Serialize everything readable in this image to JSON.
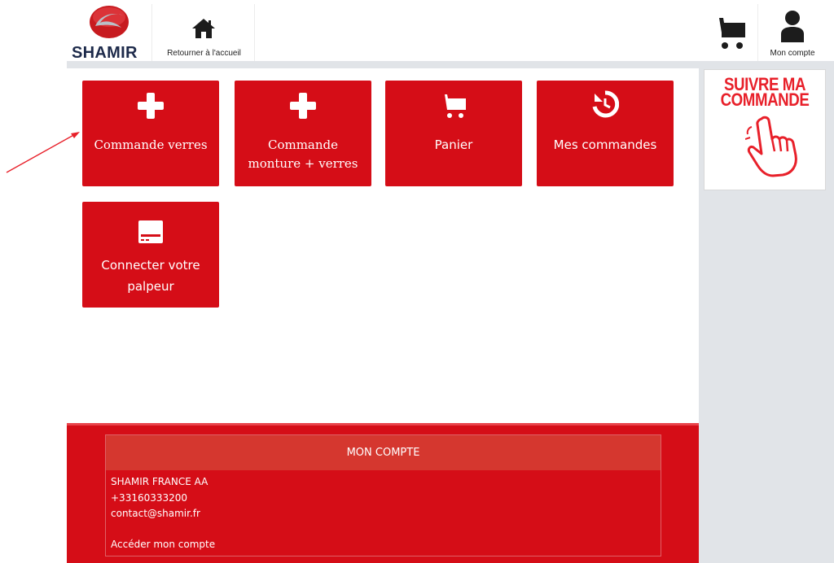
{
  "brand": {
    "name": "SHAMIR"
  },
  "header": {
    "home_label": "Retourner à l'accueil",
    "account_label": "Mon compte"
  },
  "promo": {
    "line1": "SUIVRE MA",
    "line2": "COMMANDE"
  },
  "tiles": [
    {
      "label": "Commande verres",
      "icon": "plus-icon"
    },
    {
      "label_line1": "Commande",
      "label_line2": "monture + verres",
      "icon": "plus-icon"
    },
    {
      "label": "Panier",
      "icon": "cart-icon"
    },
    {
      "label": "Mes commandes",
      "icon": "history-icon"
    },
    {
      "label_line1": "Connecter votre",
      "label_line2": "palpeur",
      "icon": "device-icon"
    }
  ],
  "footer": {
    "title": "MON COMPTE",
    "company": "SHAMIR FRANCE AA",
    "phone": "+33160333200",
    "email": "contact@shamir.fr",
    "account_link": "Accéder mon compte"
  },
  "colors": {
    "primary": "#d50d17",
    "header_bar": "#e1e4e8",
    "logo_text": "#1d2a4a"
  }
}
